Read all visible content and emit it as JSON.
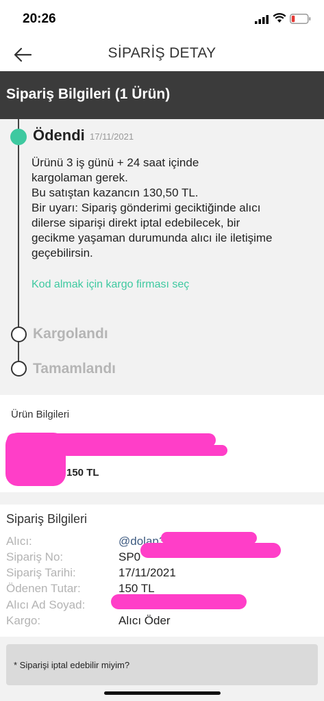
{
  "status_bar": {
    "time": "20:26"
  },
  "nav": {
    "title": "SİPARİŞ DETAY"
  },
  "section_header": {
    "title": "Sipariş Bilgileri (1 Ürün)"
  },
  "timeline": {
    "active_step": {
      "title": "Ödendi",
      "date": "17/11/2021"
    },
    "message_lines": [
      "Ürünü 3 iş günü + 24 saat içinde",
      "kargolaman gerek.",
      "Bu satıştan kazancın 130,50 TL.",
      "Bir uyarı: Sipariş gönderimi geciktiğinde alıcı",
      "dilerse siparişi direkt iptal edebilecek, bir",
      "gecikme yaşaman durumunda alıcı ile iletişime",
      "geçebilirsin."
    ],
    "cargo_link": "Kod almak için kargo firması seç",
    "pending_steps": [
      "Kargolandı",
      "Tamamlandı"
    ]
  },
  "product": {
    "label": "Ürün Bilgileri",
    "price": "150 TL"
  },
  "order_info": {
    "title": "Sipariş Bilgileri",
    "rows": [
      {
        "label": "Alıcı:",
        "value": "@dolap3"
      },
      {
        "label": "Sipariş No:",
        "value": "SP0"
      },
      {
        "label": "Sipariş Tarihi:",
        "value": "17/11/2021"
      },
      {
        "label": "Ödenen Tutar:",
        "value": "150 TL"
      },
      {
        "label": "Alıcı Ad Soyad:",
        "value": ""
      },
      {
        "label": "Kargo:",
        "value": "Alıcı Öder"
      }
    ]
  },
  "faq": {
    "question": "* Siparişi iptal edebilir miyim?"
  },
  "colors": {
    "accent": "#3ec9a0",
    "header_bg": "#3b3b3b",
    "redaction": "#ff3ec8"
  }
}
